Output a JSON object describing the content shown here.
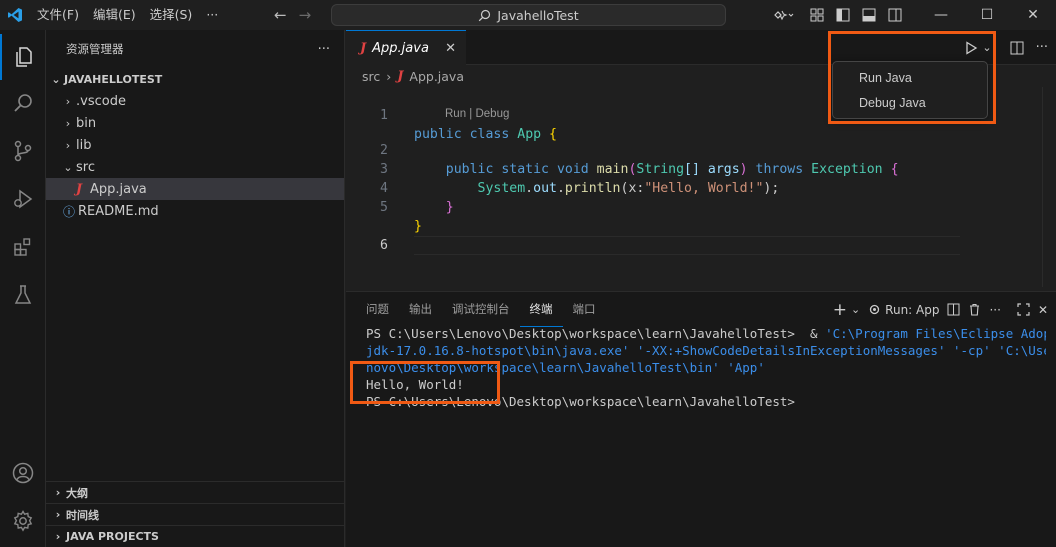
{
  "titlebar": {
    "menus": [
      "文件(F)",
      "编辑(E)",
      "选择(S)",
      "···"
    ],
    "search_text": "JavahelloTest"
  },
  "sidebar": {
    "title": "资源管理器",
    "more": "···",
    "root": "JAVAHELLOTEST",
    "items": [
      {
        "label": ".vscode",
        "type": "folder"
      },
      {
        "label": "bin",
        "type": "folder"
      },
      {
        "label": "lib",
        "type": "folder"
      },
      {
        "label": "src",
        "type": "folder-open"
      },
      {
        "label": "App.java",
        "type": "java-file"
      },
      {
        "label": "README.md",
        "type": "info-file"
      }
    ],
    "bottom_sections": [
      "大纲",
      "时间线",
      "JAVA PROJECTS"
    ]
  },
  "editor": {
    "tab_label": "App.java",
    "tab_close": "✕",
    "breadcrumb": {
      "folder": "src",
      "file": "App.java"
    },
    "codelens": "Run | Debug",
    "line_numbers": [
      "1",
      "2",
      "3",
      "4",
      "5",
      "6"
    ],
    "code": {
      "l1": {
        "kw1": "public",
        "kw2": "class",
        "cls": "App",
        "brace": "{"
      },
      "l2": {
        "kw1": "public",
        "kw2": "static",
        "kw3": "void",
        "fn": "main",
        "p1": "(",
        "type": "String",
        "arr": "[]",
        "arg": "args",
        "p2": ")",
        "kw4": "throws",
        "exc": "Exception",
        "brace": "{"
      },
      "l3": {
        "cls": "System",
        "dot1": ".",
        "var": "out",
        "dot2": ".",
        "fn": "println",
        "p1": "(",
        "hint": "x:",
        "str": "\"Hello, World!\"",
        "p2": ");"
      },
      "l4": {
        "brace": "}"
      },
      "l5": {
        "brace": "}"
      }
    }
  },
  "run_menu": {
    "items": [
      "Run Java",
      "Debug Java"
    ],
    "highlight_color": "#f05a14"
  },
  "panel": {
    "tabs": [
      "问题",
      "输出",
      "调试控制台",
      "终端",
      "端口"
    ],
    "active_tab": "终端",
    "run_label": "Run: App",
    "terminal_lines": {
      "l1_prompt": "PS C:\\Users\\Lenovo\\Desktop\\workspace\\learn\\JavahelloTest>  & ",
      "l1_path": "'C:\\Program Files\\Eclipse Adoptium\\",
      "l2a": "jdk-17.0.16.8-hotspot\\bin\\java.exe'",
      "l2b": " '-XX:+ShowCodeDetailsInExceptionMessages' '-cp' 'C:\\Users\\Le",
      "l3": "novo\\Desktop\\workspace\\learn\\JavahelloTest\\bin' 'App'",
      "l4": "Hello, World!",
      "l5": "PS C:\\Users\\Lenovo\\Desktop\\workspace\\learn\\JavahelloTest>"
    }
  }
}
